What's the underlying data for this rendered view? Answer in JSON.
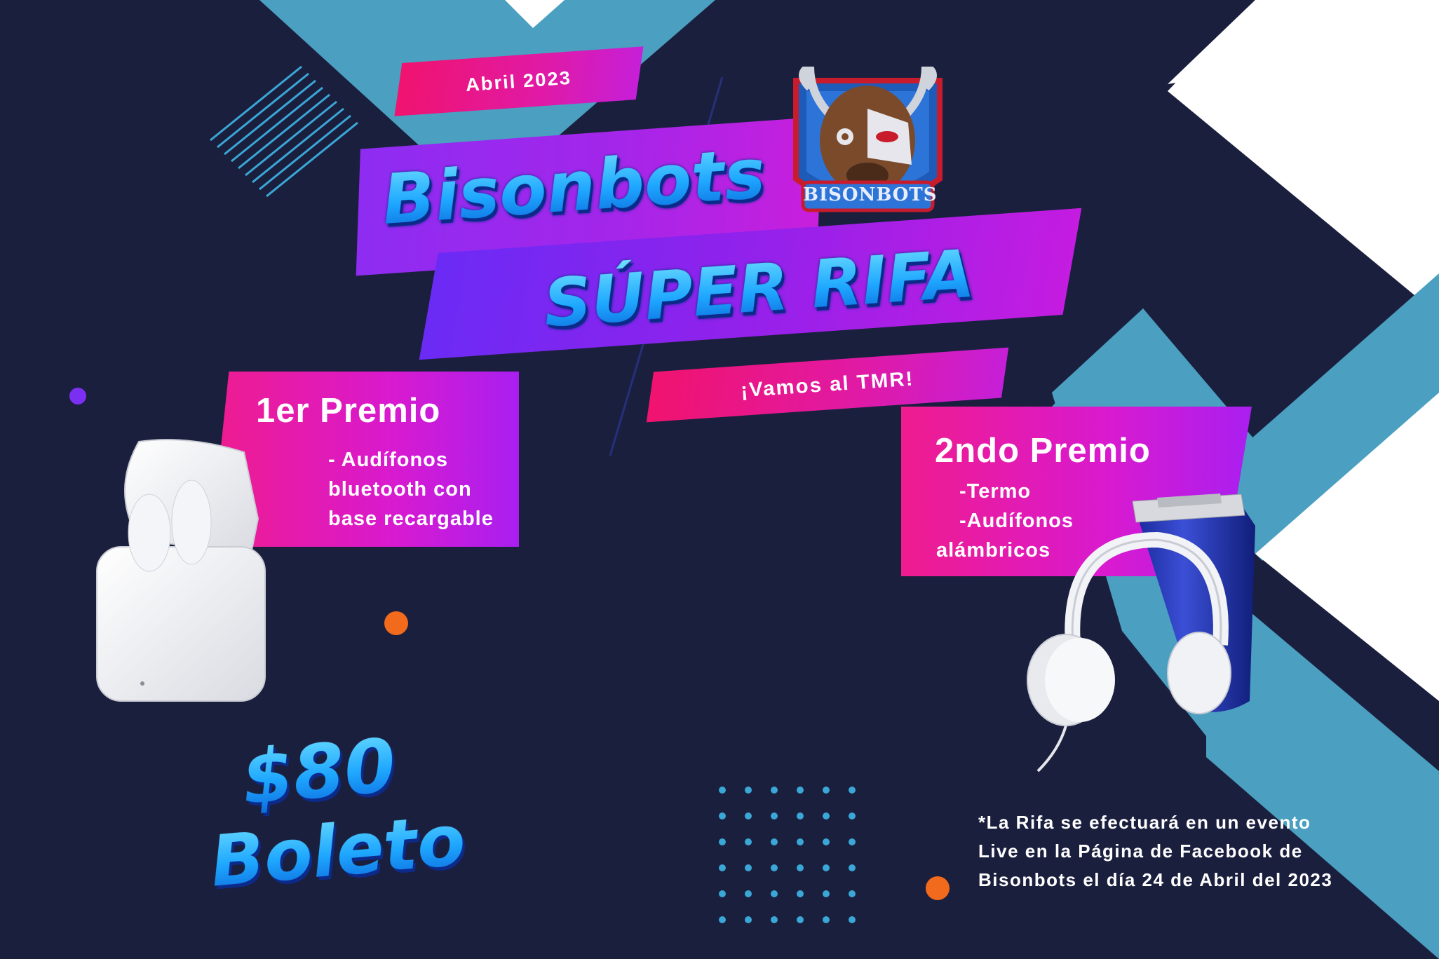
{
  "header": {
    "date_tag": "Abril 2023",
    "title_line1": "Bisonbots",
    "title_line2": "SÚPER RIFA",
    "tagline": "¡Vamos al TMR!"
  },
  "logo": {
    "text": "BISONBOTS"
  },
  "first_prize": {
    "title": "1er Premio",
    "items": [
      "- Audífonos",
      "bluetooth con",
      "base recargable"
    ]
  },
  "second_prize": {
    "title": "2ndo Premio",
    "items": [
      "-Termo",
      "-Audífonos",
      "alámbricos"
    ]
  },
  "ticket": {
    "price": "$80",
    "label": "Boleto"
  },
  "footnote": {
    "lines": [
      "*La Rifa se efectuará en un evento",
      "Live en la Página de Facebook de",
      "Bisonbots el día 24 de Abril del 2023"
    ]
  },
  "colors": {
    "background": "#1b1f3e",
    "teal_accent": "#4b9fc0",
    "pink": "#ef1c8e",
    "purple": "#9a1ff0",
    "orange_dot": "#f26a1b",
    "purple_dot": "#7b2ff2"
  }
}
